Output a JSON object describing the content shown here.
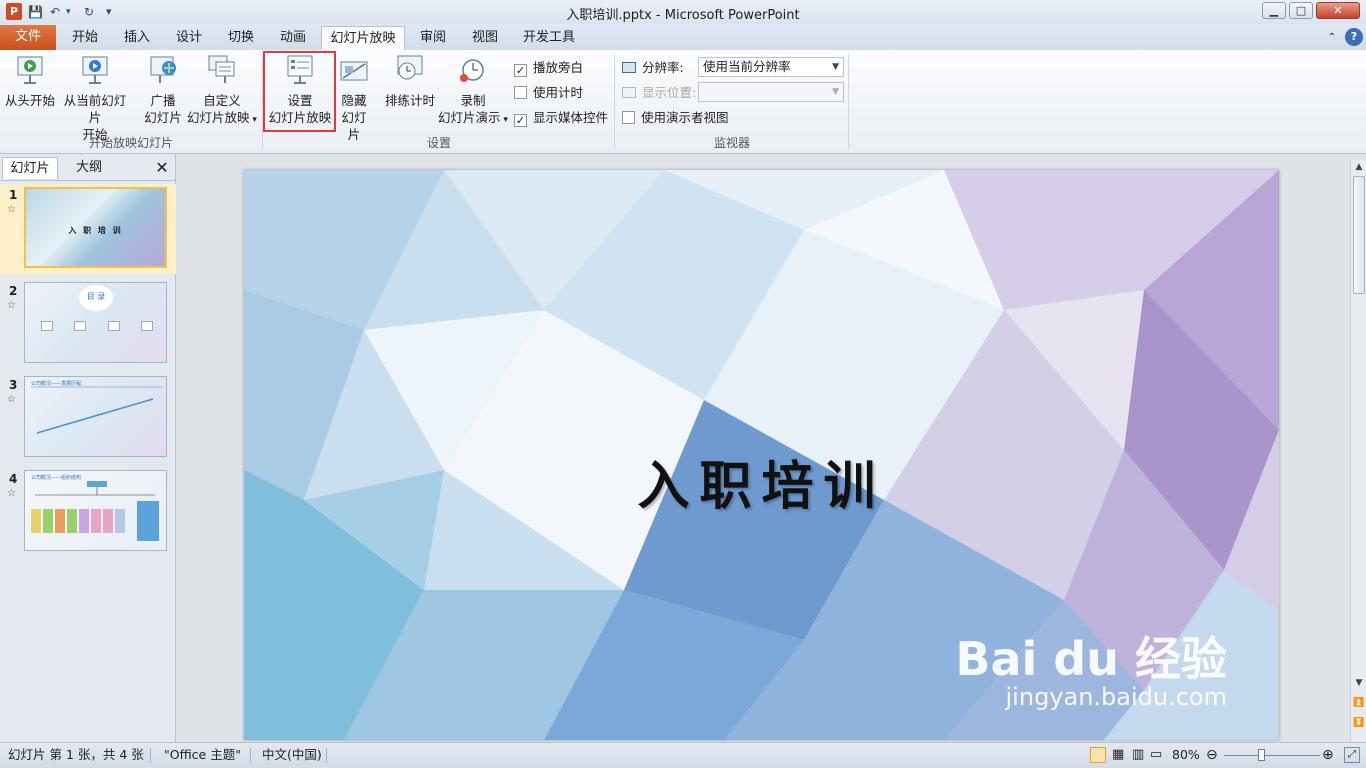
{
  "window": {
    "title": "入职培训.pptx - Microsoft PowerPoint",
    "app_icon": "P",
    "controls": {
      "minimize": "▁",
      "maximize": "□",
      "close": "✕"
    }
  },
  "tabs": [
    {
      "label": "文件",
      "kind": "file"
    },
    {
      "label": "开始"
    },
    {
      "label": "插入"
    },
    {
      "label": "设计"
    },
    {
      "label": "切换"
    },
    {
      "label": "动画"
    },
    {
      "label": "幻灯片放映",
      "active": true
    },
    {
      "label": "审阅"
    },
    {
      "label": "视图"
    },
    {
      "label": "开发工具"
    }
  ],
  "ribbon": {
    "groups": {
      "start_slideshow": "开始放映幻灯片",
      "setup": "设置",
      "monitors": "监视器"
    },
    "buttons": {
      "from_beginning": "从头开始",
      "from_current_line1": "从当前幻灯片",
      "from_current_line2": "开始",
      "broadcast_line1": "广播",
      "broadcast_line2": "幻灯片",
      "custom_line1": "自定义",
      "custom_line2": "幻灯片放映",
      "setup_line1": "设置",
      "setup_line2": "幻灯片放映",
      "hide_line1": "隐藏",
      "hide_line2": "幻灯片",
      "rehearse": "排练计时",
      "record_line1": "录制",
      "record_line2": "幻灯片演示"
    },
    "checkboxes": {
      "play_narrations": {
        "label": "播放旁白",
        "checked": true
      },
      "use_timings": {
        "label": "使用计时",
        "checked": false
      },
      "show_media_controls": {
        "label": "显示媒体控件",
        "checked": true
      },
      "presenter_view": {
        "label": "使用演示者视图",
        "checked": false
      }
    },
    "resolution": {
      "label": "分辨率:",
      "value": "使用当前分辨率"
    },
    "show_on": {
      "label": "显示位置:",
      "value": ""
    }
  },
  "panel": {
    "tab_slides": "幻灯片",
    "tab_outline": "大纲",
    "close": "✕",
    "slides": [
      {
        "num": "1",
        "text": "入 职 培 训",
        "selected": true
      },
      {
        "num": "2",
        "text": "目 录"
      },
      {
        "num": "3",
        "text": "公司概况——发展历程"
      },
      {
        "num": "4",
        "text": "公司概况——组织结构"
      }
    ],
    "star": "☆"
  },
  "slide": {
    "title": "入职培训"
  },
  "watermark": {
    "brand": "Bai du 经验",
    "url": "jingyan.baidu.com"
  },
  "status": {
    "slide_info": "幻灯片 第 1 张，共 4 张",
    "theme": "\"Office 主题\"",
    "language": "中文(中国)",
    "zoom": "80%"
  }
}
